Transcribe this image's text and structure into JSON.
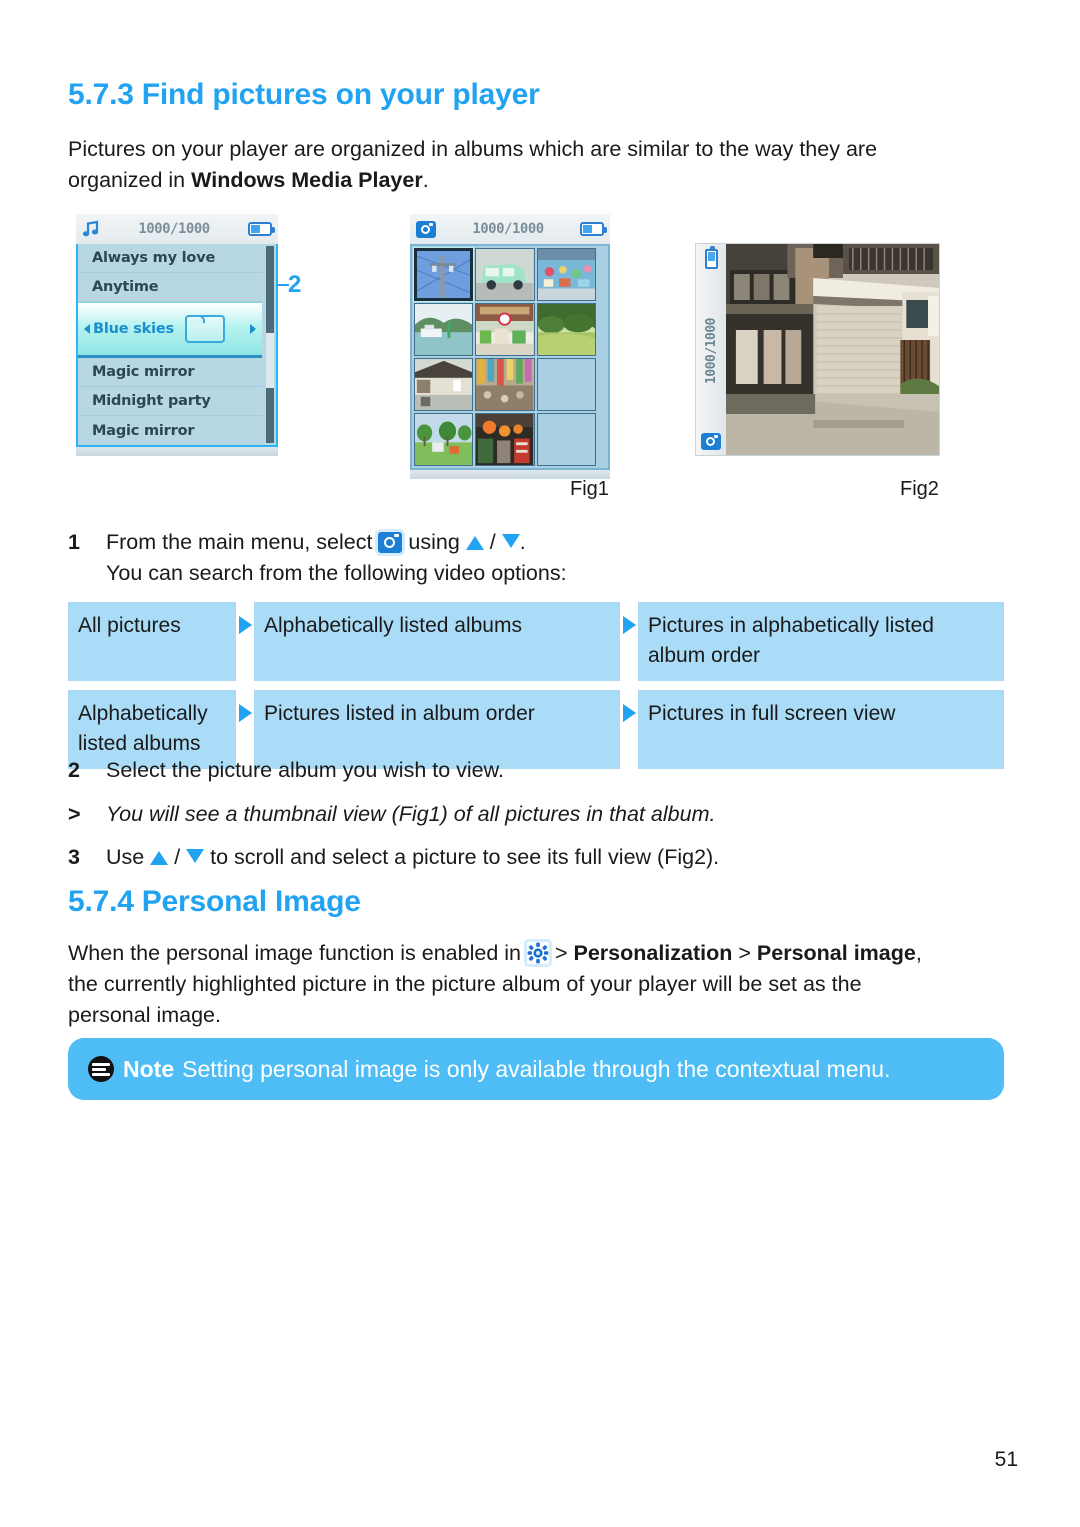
{
  "document": {
    "page_number": "51",
    "accent_color": "#22a3f1",
    "table_cell_color": "#aadcf7",
    "note_bar_color": "#4fbdf5"
  },
  "section_573": {
    "number": "5.7.3",
    "title": "Find pictures on your player",
    "intro_line1": "Pictures on your player are organized in albums which are similar to the way they are",
    "intro_line2_prefix": "organized in ",
    "intro_line2_bold": "Windows Media Player",
    "intro_line2_suffix": "."
  },
  "callout": {
    "label": "2"
  },
  "device_list": {
    "status_count": "1000/1000",
    "note_icon": "music-note-icon",
    "battery_icon": "battery-icon",
    "rows": [
      {
        "label": "Always my love",
        "selected": false
      },
      {
        "label": "Anytime",
        "selected": false
      },
      {
        "label": "Blue skies",
        "selected": true
      },
      {
        "label": "Magic mirror",
        "selected": false
      },
      {
        "label": "Midnight party",
        "selected": false
      },
      {
        "label": "Magic mirror",
        "selected": false
      }
    ]
  },
  "device_grid": {
    "status_count": "1000/1000",
    "camera_icon": "camera-icon",
    "battery_icon": "battery-icon",
    "thumbnails": [
      {
        "name": "utility-pole-photo",
        "filled": true,
        "selected": true
      },
      {
        "name": "green-minivan-photo",
        "filled": true,
        "selected": false
      },
      {
        "name": "painted-bus-photo",
        "filled": true,
        "selected": false
      },
      {
        "name": "harbour-boat-photo",
        "filled": true,
        "selected": false
      },
      {
        "name": "street-market-photo",
        "filled": true,
        "selected": false
      },
      {
        "name": "green-garden-photo",
        "filled": true,
        "selected": false
      },
      {
        "name": "old-house-photo",
        "filled": true,
        "selected": false
      },
      {
        "name": "shopping-street-photo",
        "filled": true,
        "selected": false
      },
      {
        "name": "park-trees-photo",
        "filled": true,
        "selected": false
      },
      {
        "name": "red-lanterns-photo",
        "filled": true,
        "selected": false
      },
      {
        "name": "empty-slot",
        "filled": false,
        "selected": false
      },
      {
        "name": "empty-slot",
        "filled": false,
        "selected": false
      }
    ],
    "fig_label": "Fig1"
  },
  "device_full": {
    "status_count": "1000/1000",
    "battery_icon": "battery-icon",
    "camera_icon": "camera-icon",
    "photo_name": "japanese-street-house-photo",
    "fig_label": "Fig2"
  },
  "steps": [
    {
      "num": "1",
      "line1_prefix": "From the main menu, select ",
      "line1_icon": "camera-icon",
      "line1_mid": " using ",
      "line1_up": "up-triangle-icon",
      "line1_sep": " / ",
      "line1_down": "down-triangle-icon",
      "line1_suffix": ".",
      "line2": "You can search from the following video options:"
    },
    {
      "num": "2",
      "text": "Select the picture album you wish to view."
    },
    {
      "num": ">",
      "text": "You will see a thumbnail view (Fig1) of all pictures in that album.",
      "italic": true
    },
    {
      "num": "3",
      "prefix": "Use ",
      "up": "up-triangle-icon",
      "sep": " / ",
      "down": "down-triangle-icon",
      "suffix": " to scroll and select a picture to see its full view (Fig2)."
    }
  ],
  "options_table": {
    "rows": [
      {
        "col1": "All pictures",
        "col2": "Alphabetically listed albums",
        "col3": "Pictures in alphabetically listed album order"
      },
      {
        "col1": "Alphabetically listed albums",
        "col2": "Pictures listed in album order",
        "col3": "Pictures in full screen view"
      }
    ]
  },
  "section_574": {
    "number": "5.7.4",
    "title": "Personal Image",
    "body_prefix": "When the personal image function is enabled in ",
    "gear_icon": "gear-icon",
    "body_gt1": " > ",
    "body_bold1": "Personalization",
    "body_gt2": " > ",
    "body_bold2": "Personal image",
    "body_after": ",",
    "body_line2": "the currently highlighted picture in the picture album of your player will be set as the",
    "body_line3": "personal image."
  },
  "note": {
    "label": "Note",
    "text": "Setting personal image is only available through the contextual menu."
  }
}
